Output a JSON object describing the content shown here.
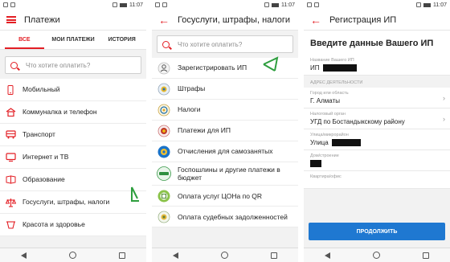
{
  "status_time": "11:07",
  "screen1": {
    "title": "Платежи",
    "tabs": [
      {
        "label": "ВСЕ"
      },
      {
        "label": "МОИ ПЛАТЕЖИ"
      },
      {
        "label": "ИСТОРИЯ"
      }
    ],
    "search_placeholder": "Что хотите оплатить?",
    "items": [
      {
        "label": "Мобильный",
        "icon": "mobile-icon"
      },
      {
        "label": "Коммуналка и телефон",
        "icon": "utilities-icon"
      },
      {
        "label": "Транспорт",
        "icon": "bus-icon"
      },
      {
        "label": "Интернет и ТВ",
        "icon": "tv-icon"
      },
      {
        "label": "Образование",
        "icon": "education-icon"
      },
      {
        "label": "Госуслуги, штрафы, налоги",
        "icon": "scales-icon"
      },
      {
        "label": "Красота и здоровье",
        "icon": "beauty-icon"
      }
    ]
  },
  "screen2": {
    "title": "Госуслуги, штрафы, налоги",
    "search_placeholder": "Что хотите оплатить?",
    "items": [
      {
        "label": "Зарегистрировать ИП",
        "icon": "register-icon"
      },
      {
        "label": "Штрафы",
        "icon": "fines-icon"
      },
      {
        "label": "Налоги",
        "icon": "taxes-icon"
      },
      {
        "label": "Платежи для ИП",
        "icon": "ip-payments-icon"
      },
      {
        "label": "Отчисления для самозанятых",
        "icon": "self-employed-icon"
      },
      {
        "label": "Госпошлины и другие платежи в бюджет",
        "icon": "egov-icon"
      },
      {
        "label": "Оплата услуг ЦОНа по QR",
        "icon": "qr-icon"
      },
      {
        "label": "Оплата судебных задолженностей",
        "icon": "court-icon"
      }
    ]
  },
  "screen3": {
    "title": "Регистрация ИП",
    "heading": "Введите данные Вашего ИП",
    "name_label": "Название Вашего ИП",
    "name_value": "ИП",
    "section_label": "АДРЕС ДЕЯТЕЛЬНОСТИ",
    "city_label": "Город или область",
    "city_value": "Г. Алматы",
    "tax_label": "Налоговый орган",
    "tax_value": "УГД по Бостандыкскому району",
    "street_label": "Улица/микрорайон",
    "street_value": "Улица",
    "house_label": "Дом/строение",
    "apt_label": "Квартира/офис",
    "continue_label": "ПРОДОЛЖИТЬ"
  },
  "colors": {
    "accent": "#e31e24",
    "primary_button": "#1f78d1",
    "annotation": "#2e9e3e"
  }
}
